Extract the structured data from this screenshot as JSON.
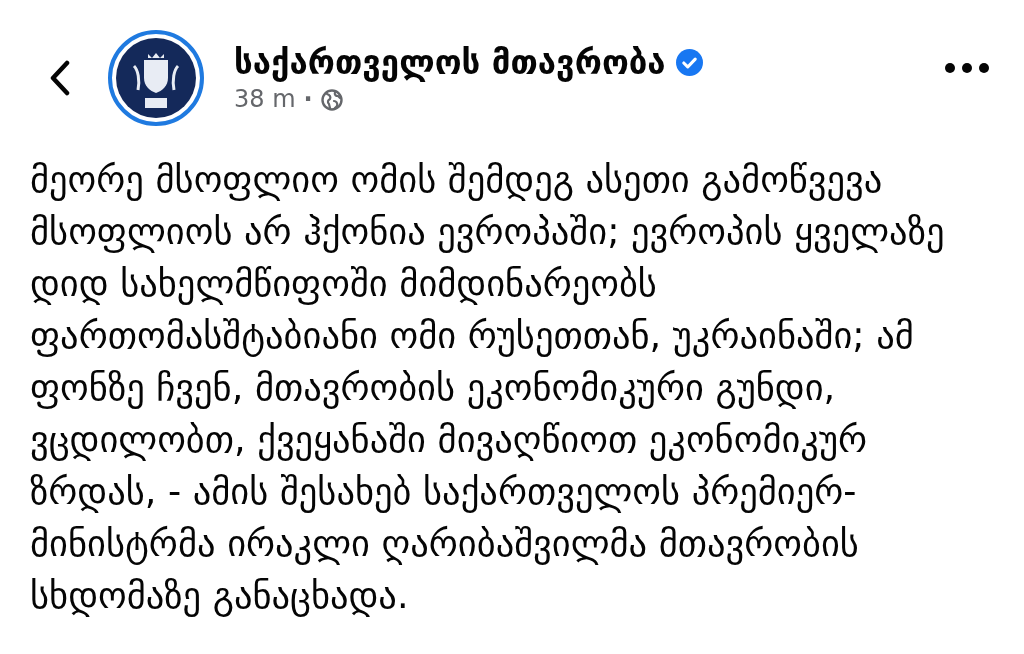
{
  "post": {
    "author": "საქართველოს მთავრობა",
    "verified": true,
    "time": "38 m",
    "separator": "·",
    "text": "მეორე მსოფლიო ომის შემდეგ ასეთი გამოწვევა მსოფლიოს არ ჰქონია ევროპაში; ევროპის ყველაზე დიდ სახელმწიფოში მიმდინარეობს ფართომასშტაბიანი ომი რუსეთთან, უკრაინაში; ამ ფონზე ჩვენ, მთავრობის ეკონომიკური გუნდი, ვცდილობთ, ქვეყანაში მივაღწიოთ ეკონომიკურ ზრდას, - ამის შესახებ საქართველოს პრემიერ-მინისტრმა ირაკლი ღარიბაშვილმა მთავრობის სხდომაზე განაცხადა."
  }
}
